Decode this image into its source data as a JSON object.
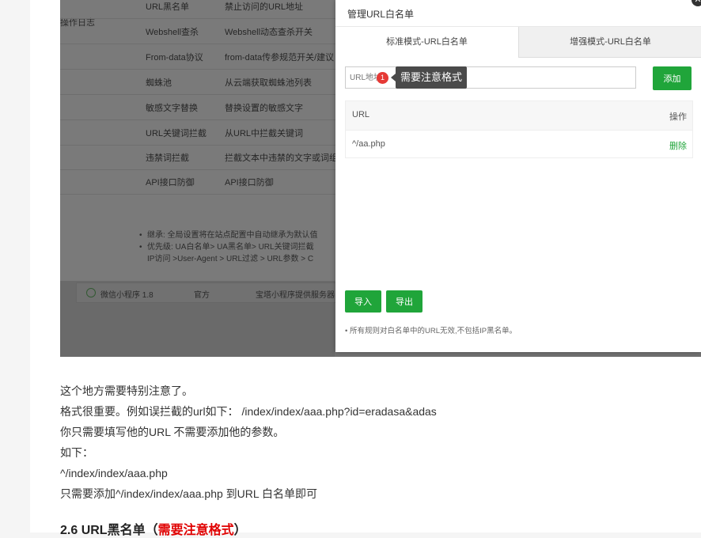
{
  "background_panel": {
    "side_label": "操作日志",
    "rows": [
      {
        "name": "URL黑名单",
        "desc": "禁止访问的URL地址"
      },
      {
        "name": "Webshell查杀",
        "desc": "Webshell动态查杀开关"
      },
      {
        "name": "From-data协议",
        "desc": "from-data传参规范开关/建议"
      },
      {
        "name": "蜘蛛池",
        "desc": "从云端获取蜘蛛池列表"
      },
      {
        "name": "敏感文字替换",
        "desc": "替换设置的敏感文字"
      },
      {
        "name": "URL关键词拦截",
        "desc": "从URL中拦截关键词"
      },
      {
        "name": "违禁词拦截",
        "desc": "拦截文本中违禁的文字或词组"
      },
      {
        "name": "API接口防御",
        "desc": "API接口防御"
      }
    ],
    "notes": [
      "继承: 全局设置将在站点配置中自动继承为默认值",
      "优先级: UA白名单> UA黑名单> URL关键词拦截",
      "IP访问 >User-Agent > URL过滤 > URL参数 > C"
    ],
    "bottom_row": {
      "name": "微信小程序 1.8",
      "vendor": "官方",
      "desc": "宝塔小程序提供服务器"
    }
  },
  "modal": {
    "title": "管理URL白名单",
    "tabs": [
      "标准模式-URL白名单",
      "增强模式-URL白名单"
    ],
    "input_placeholder": "URL地址",
    "badge_number": "1",
    "tooltip": "需要注意格式",
    "add_button": "添加",
    "table": {
      "headers": [
        "URL",
        "操作"
      ],
      "rows": [
        {
          "url": "^/aa.php",
          "action": "删除"
        }
      ]
    },
    "import_button": "导入",
    "export_button": "导出",
    "note": "所有规则对白名单中的URL无效,不包括IP黑名单。"
  },
  "article": {
    "lines": [
      "这个地方需要特别注意了。",
      "格式很重要。例如误拦截的url如下： /index/index/aaa.php?id=eradasa&adas",
      "你只需要填写他的URL 不需要添加他的参数。",
      "如下：",
      "^/index/index/aaa.php",
      "只需要添加^/index/index/aaa.php 到URL 白名单即可"
    ],
    "heading_prefix": "2.6 URL黑名单（",
    "heading_red": "需要注意格式",
    "heading_suffix": "）"
  }
}
